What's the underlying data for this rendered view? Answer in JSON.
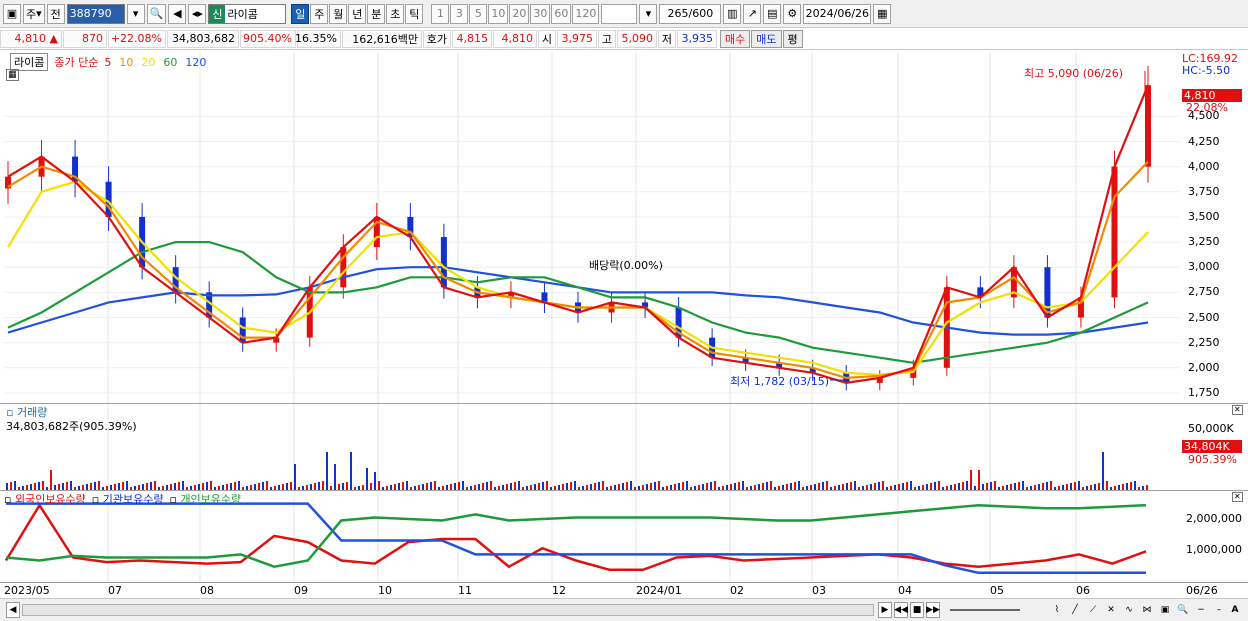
{
  "toolbar": {
    "period_main": "주",
    "type_label": "전",
    "stock_code": "388790",
    "stock_name": "라이콤",
    "name_badge": "신",
    "periods": [
      "일",
      "주",
      "월",
      "년",
      "분",
      "초",
      "틱"
    ],
    "active_period": "일",
    "intervals": [
      "1",
      "3",
      "5",
      "10",
      "20",
      "30",
      "60",
      "120"
    ],
    "count": "265",
    "count_total": "/600",
    "date": "2024/06/26"
  },
  "infobar": {
    "price": "4,810",
    "change": "870",
    "change_pct": "+22.08%",
    "volume": "34,803,682",
    "volume_pct": "905.40%",
    "turnover": "16.35%",
    "amount": "162,616백만",
    "bid_label": "호가",
    "bid": "4,815",
    "ask": "4,810",
    "open_label": "시",
    "open": "3,975",
    "high_label": "고",
    "high": "5,090",
    "low_label": "저",
    "low": "3,935",
    "buy_button": "매수",
    "sell_button": "매도",
    "eval_button": "평"
  },
  "price_panel": {
    "name_tag": "라이콤",
    "legend_prefix": "종가 단순",
    "ma_labels": [
      "5",
      "10",
      "20",
      "60",
      "120"
    ],
    "ma_colors": [
      "#e01010",
      "#f08a00",
      "#f2e000",
      "#1f9a3a",
      "#2050e0"
    ],
    "lc_label": "LC:169.92",
    "hc_label": "HC:-5.50",
    "current_tag": "4,810",
    "current_pct": "22.08%",
    "high_annotation": "최고 5,090 (06/26)",
    "low_annotation": "최저 1,782 (03/15)",
    "dividend_annotation": "배당락(0.00%)",
    "y_ticks": [
      "4,500",
      "4,250",
      "4,000",
      "3,750",
      "3,500",
      "3,250",
      "3,000",
      "2,750",
      "2,500",
      "2,250",
      "2,000",
      "1,750"
    ]
  },
  "volume_panel": {
    "title": "거래량",
    "value_text": "34,803,682주(905.39%)",
    "axis_tick": "50,000K",
    "current_tag": "34,804K",
    "current_pct": "905.39%"
  },
  "holding_panel": {
    "legend": [
      "외국인보유수량",
      "기관보유수량",
      "개인보유수량"
    ],
    "legend_colors": [
      "#e01010",
      "#2050e0",
      "#1f9a3a"
    ],
    "y_ticks": [
      "2,000,000",
      "1,000,000"
    ]
  },
  "date_axis": [
    "2023/05",
    "07",
    "08",
    "09",
    "10",
    "11",
    "12",
    "2024/01",
    "02",
    "03",
    "04",
    "05",
    "06",
    "06/26"
  ],
  "chart_data": [
    {
      "type": "line",
      "title": "라이콤",
      "ylim": [
        1650,
        5150
      ],
      "x_labels": [
        "2023/05",
        "07",
        "08",
        "09",
        "10",
        "11",
        "12",
        "2024/01",
        "02",
        "03",
        "04",
        "05",
        "06",
        "06/26"
      ],
      "series": [
        {
          "name": "5",
          "values": [
            3900,
            4100,
            3850,
            3500,
            3000,
            2750,
            2500,
            2250,
            2300,
            2800,
            3200,
            3500,
            3300,
            2800,
            2700,
            2750,
            2650,
            2550,
            2650,
            2600,
            2300,
            2100,
            2050,
            2000,
            1950,
            1850,
            1900,
            2000,
            2800,
            2700,
            3000,
            2500,
            2700,
            4000,
            4810
          ]
        },
        {
          "name": "10",
          "values": [
            3800,
            4000,
            3900,
            3600,
            3100,
            2800,
            2550,
            2300,
            2300,
            2700,
            3100,
            3450,
            3350,
            2900,
            2750,
            2700,
            2650,
            2600,
            2600,
            2600,
            2350,
            2150,
            2100,
            2050,
            2000,
            1900,
            1920,
            1980,
            2650,
            2700,
            2900,
            2550,
            2650,
            3700,
            4050
          ]
        },
        {
          "name": "20",
          "values": [
            3200,
            3750,
            3850,
            3650,
            3250,
            2900,
            2650,
            2400,
            2350,
            2550,
            2950,
            3300,
            3350,
            3000,
            2800,
            2700,
            2650,
            2600,
            2600,
            2600,
            2400,
            2200,
            2150,
            2100,
            2050,
            1950,
            1930,
            1960,
            2450,
            2650,
            2750,
            2600,
            2650,
            3000,
            3350
          ]
        },
        {
          "name": "60",
          "values": [
            2400,
            2550,
            2750,
            2950,
            3150,
            3250,
            3250,
            3150,
            2900,
            2750,
            2750,
            2800,
            2900,
            2900,
            2850,
            2900,
            2900,
            2800,
            2700,
            2700,
            2600,
            2450,
            2350,
            2300,
            2200,
            2150,
            2100,
            2050,
            2100,
            2150,
            2200,
            2250,
            2350,
            2500,
            2650
          ]
        },
        {
          "name": "120",
          "values": [
            2350,
            2450,
            2550,
            2650,
            2700,
            2750,
            2720,
            2720,
            2730,
            2800,
            2900,
            2980,
            3000,
            3000,
            2950,
            2900,
            2850,
            2800,
            2750,
            2750,
            2750,
            2750,
            2720,
            2700,
            2650,
            2600,
            2550,
            2450,
            2400,
            2350,
            2330,
            2330,
            2350,
            2400,
            2450
          ]
        }
      ]
    },
    {
      "type": "line",
      "title": "",
      "series": [
        {
          "name": "외국인보유수량",
          "values": [
            600000,
            2400000,
            700000,
            550000,
            600000,
            550000,
            500000,
            550000,
            1400000,
            1200000,
            600000,
            500000,
            1200000,
            1300000,
            1300000,
            400000,
            1000000,
            600000,
            300000,
            300000,
            700000,
            750000,
            600000,
            650000,
            700000,
            750000,
            800000,
            700000,
            500000,
            400000,
            500000,
            600000,
            800000,
            500000,
            900000
          ]
        },
        {
          "name": "기관보유수량",
          "values": [
            2450000,
            2450000,
            2450000,
            2450000,
            2450000,
            2450000,
            2450000,
            2450000,
            2450000,
            2450000,
            1250000,
            1250000,
            1250000,
            1250000,
            800000,
            800000,
            800000,
            800000,
            800000,
            800000,
            800000,
            800000,
            800000,
            800000,
            800000,
            800000,
            800000,
            800000,
            450000,
            200000,
            200000,
            200000,
            200000,
            200000,
            200000
          ]
        },
        {
          "name": "개인보유수량",
          "values": [
            700000,
            600000,
            750000,
            700000,
            700000,
            700000,
            700000,
            800000,
            400000,
            600000,
            1900000,
            2000000,
            1950000,
            1900000,
            2100000,
            1900000,
            1950000,
            2000000,
            2000000,
            2000000,
            2000000,
            2000000,
            1950000,
            1900000,
            1900000,
            2000000,
            2100000,
            2200000,
            2300000,
            2400000,
            2350000,
            2300000,
            2300000,
            2350000,
            2400000
          ]
        }
      ]
    }
  ]
}
